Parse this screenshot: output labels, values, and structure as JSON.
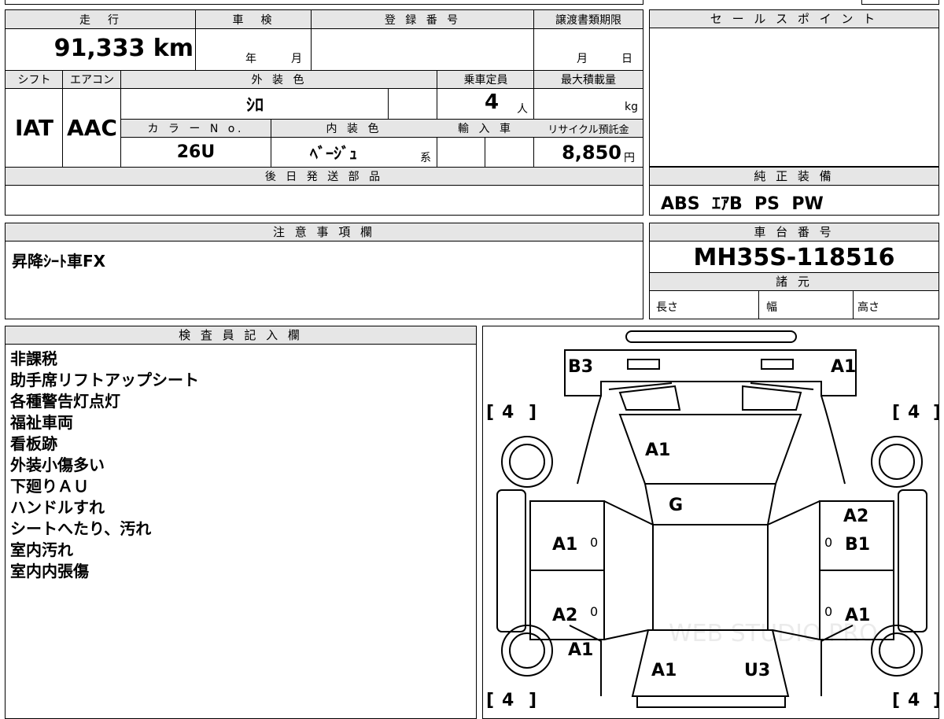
{
  "top": {
    "mileage_label": "走　行",
    "mileage_value": "91,333 km",
    "inspection_label": "車　検",
    "inspection_year": "年",
    "inspection_month": "月",
    "registration_label": "登 録 番 号",
    "transfer_deadline_label": "譲渡書類期限",
    "transfer_month": "月",
    "transfer_day": "日",
    "shift_label": "シフト",
    "ac_label": "エアコン",
    "exterior_color_label": "外 装 色",
    "capacity_label": "乗車定員",
    "max_load_label": "最大積載量",
    "shift_value": "IAT",
    "ac_value": "AAC",
    "exterior_color_value": "ｼﾛ",
    "capacity_value": "4",
    "capacity_unit": "人",
    "max_load_unit": "kg",
    "color_no_label": "カ ラ ー N o.",
    "interior_color_label": "内 装 色",
    "import_label": "輸 入 車",
    "recycle_label": "リサイクル預託金",
    "color_no_value": "26U",
    "interior_color_value": "ﾍﾞｰｼﾞｭ",
    "interior_suffix": "系",
    "recycle_value": "8,850",
    "recycle_unit": "円",
    "later_parts_label": "後 日 発 送 部 品"
  },
  "sales_point": {
    "label": "セ ー ル ス ポ イ ン ト"
  },
  "genuine_equipment": {
    "label": "純 正 装 備",
    "value": "ABS  ｴｱB  PS  PW"
  },
  "notes": {
    "label": "注 意 事 項 欄",
    "value": "昇降ｼｰﾄ車FX"
  },
  "chassis": {
    "label": "車 台 番 号",
    "value": "MH35S-118516",
    "spec_label": "諸 元",
    "length_label": "長さ",
    "width_label": "幅",
    "height_label": "高さ"
  },
  "inspector": {
    "label": "検 査 員 記 入 欄",
    "remarks": [
      "非課税",
      "助手席リフトアップシート",
      "各種警告灯点灯",
      "福祉車両",
      "看板跡",
      "外装小傷多い",
      "下廻りＡＵ",
      "ハンドルすれ",
      "シートへたり、汚れ",
      "室内汚れ",
      "室内内張傷"
    ]
  },
  "diagram": {
    "marks": {
      "rear_left": "B3",
      "rear_right": "A1",
      "roof": "A1",
      "glass": "G",
      "front_left_door": "A1",
      "rear_left_door": "A2",
      "front_right_door_top": "A2",
      "front_right_door": "B1",
      "rear_right_door": "A1",
      "left_fender": "A1",
      "hood": "A1",
      "front_right": "U3"
    },
    "door_zero": "0",
    "tire_tread": "4",
    "watermark": "WEB STUDIO PRO"
  }
}
